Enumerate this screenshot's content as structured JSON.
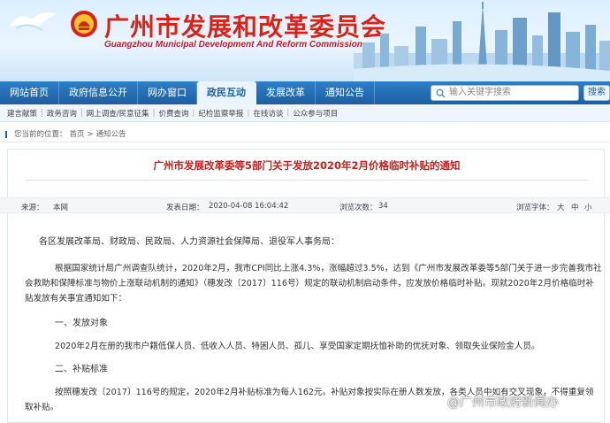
{
  "site": {
    "title_cn": "广州市发展和改革委员会",
    "title_en": "Guangzhou Municipal Development And Reform Commission"
  },
  "nav": {
    "items": [
      {
        "label": "网站首页",
        "active": false
      },
      {
        "label": "政府信息公开",
        "active": false
      },
      {
        "label": "网办窗口",
        "active": false
      },
      {
        "label": "政民互动",
        "active": true
      },
      {
        "label": "发展改革",
        "active": false
      },
      {
        "label": "通知公告",
        "active": false
      }
    ],
    "search_placeholder": "输入关键字搜索",
    "search_button": "搜索"
  },
  "subnav": {
    "items": [
      "建言献策",
      "政务咨询",
      "网上调查/民意征集",
      "价费查询",
      "纪检监察举报",
      "在线访谈",
      "公众参与项目"
    ]
  },
  "breadcrumb": {
    "prefix": "您当前的位置：",
    "home": "首页",
    "sep": ">",
    "current": "通知公告"
  },
  "article": {
    "title": "广州市发展改革委等5部门关于发放2020年2月价格临时补贴的通知",
    "meta": {
      "source_label": "来源：",
      "source": "本网",
      "time_label": "发表日期：",
      "time": "2020-04-08 16:04:42",
      "views_label": "浏览次数：",
      "views": "34",
      "font_label": "浏览字体：",
      "font_large": "大",
      "font_medium": "中",
      "font_small": "小"
    },
    "salutation": "各区发展改革局、财政局、民政局、人力资源社会保障局、退役军人事务局：",
    "para1": "根据国家统计局广州调查队统计，2020年2月，我市CPI同比上涨4.3%，涨幅超过3.5%，达到《广州市发展改革委等5部门关于进一步完善我市社会救助和保障标准与物价上涨联动机制的通知》（穗发改〔2017〕116号）规定的联动机制启动条件，应发放价格临时补贴。现就2020年2月价格临时补贴发放有关事宜通知如下：",
    "para1_lines": [
      "根据国家统计局广州调查队统计，2020年2月，我市CPI同比上涨4.3%，涨幅超过3.5%，达到《广州市发展改革委等5部门关于进一步完善我市社",
      "会救助和保障标准与物价上涨联动机制的通知》（穗发改〔2017〕116号）规定的联动机制启动条件，应发放价格临时补贴。现就2020年2月价格临时补",
      "贴发放有关事宜通知如下："
    ],
    "heading1": "一、发放对象",
    "para2": "2020年2月在册的我市户籍低保人员、低收入人员、特困人员、孤儿、享受国家定期抚恤补助的优抚对象、领取失业保险金人员。",
    "heading2": "二、补贴标准",
    "para3_lines": [
      "按照穗发改〔2017〕116号的规定，2020年2月补贴标准为每人162元。补贴对象按实际在册人数发放，各类人员中如有交叉现象，不得重复领",
      "取补贴。"
    ]
  },
  "watermark": "@广州市政府新闻办",
  "colors": {
    "brand_red": "#d8231b",
    "nav_blue": "#1b5fa6",
    "title_red": "#c4201c"
  }
}
